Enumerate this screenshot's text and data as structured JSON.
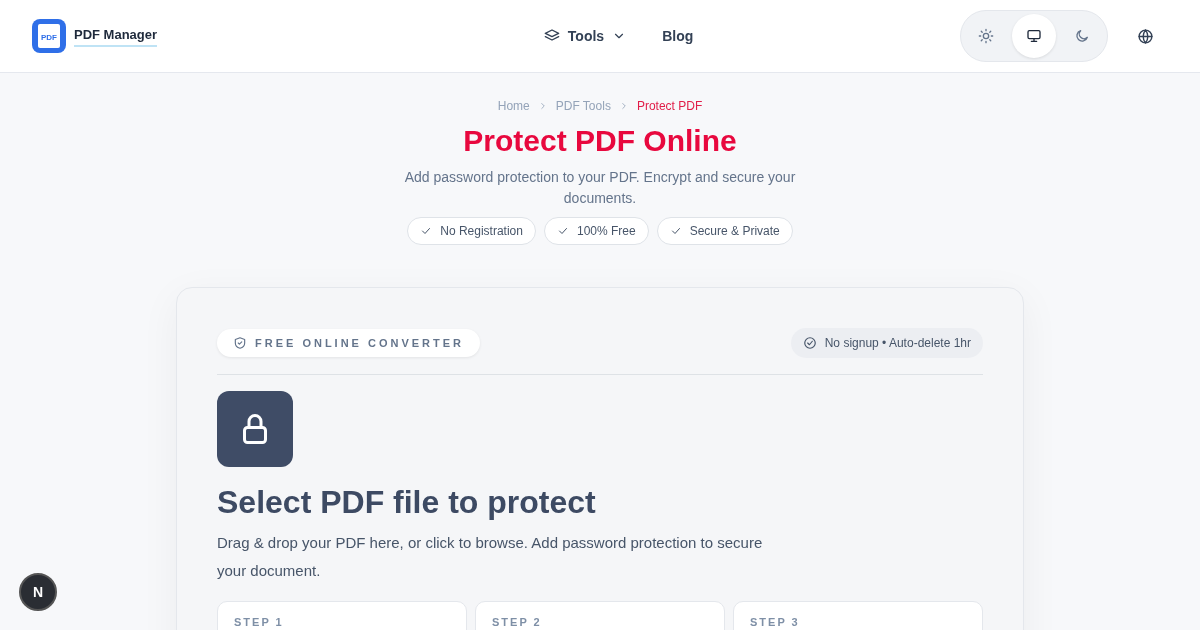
{
  "header": {
    "brand": "PDF Manager",
    "logo_text": "PDF",
    "nav": [
      {
        "label": "Tools",
        "kind": "dropdown"
      },
      {
        "label": "Blog",
        "kind": "link"
      }
    ],
    "theme_options": [
      {
        "kind": "light",
        "selected": false
      },
      {
        "kind": "system",
        "selected": true
      },
      {
        "kind": "dark",
        "selected": false
      }
    ]
  },
  "breadcrumb": [
    {
      "label": "Home",
      "selected": false
    },
    {
      "label": "PDF Tools",
      "selected": false
    },
    {
      "label": "Protect PDF",
      "selected": true
    }
  ],
  "title": "Protect PDF Online",
  "subtitle": "Add password protection to your PDF. Encrypt and secure your documents.",
  "features": [
    "No Registration",
    "100% Free",
    "Secure & Private"
  ],
  "card": {
    "badge": "FREE ONLINE CONVERTER",
    "note": "No signup • Auto-delete 1hr",
    "heading": "Select PDF file to protect",
    "description": "Drag & drop your PDF here, or click to browse. Add password protection to secure your document.",
    "steps": [
      "STEP 1",
      "STEP 2",
      "STEP 3"
    ]
  },
  "dev_badge": "N"
}
